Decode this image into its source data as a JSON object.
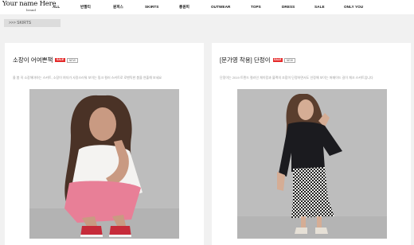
{
  "header": {
    "logo_text": "Your name Here",
    "logo_sub": "brand",
    "nav": [
      {
        "label": "ALL"
      },
      {
        "label": "반팔티"
      },
      {
        "label": "원피스"
      },
      {
        "label": "SKIRTS"
      },
      {
        "label": "롱원피"
      },
      {
        "label": "OUTWEAR"
      },
      {
        "label": "TOPS"
      },
      {
        "label": "DRESS"
      },
      {
        "label": "SALE"
      },
      {
        "label": "ONLY YOU"
      }
    ]
  },
  "breadcrumb": {
    "text": ">>> SKIRTS"
  },
  "products": [
    {
      "title": "소장이 어여쁜책",
      "badge_sale": "SALE",
      "badge_new": "NEW",
      "description": "올 봄 꼭 소장해야하는 스커트, 소장이 여자가 사랑스러워 보이는 핑크 컬러 스커트로 로맨틱한 봄을 연출해 보세요",
      "image_alt": "girl in white t-shirt and pink skirt crouching"
    },
    {
      "title": "[문가영 착용] 단정이",
      "badge_sale": "SALE",
      "badge_new": "NEW",
      "description": "단정이는 2019 트렌드 컬러인 체이킹과 블랙의 조합이 단정하면서도 인정해 보이는 머메이드 길이 체크 스커트입니다",
      "image_alt": "model in black blouse and houndstooth mermaid skirt"
    }
  ],
  "colors": {
    "background": "#f1f1f1",
    "badge_sale": "#e52b2b",
    "skirt_pink": "#e87f97"
  }
}
